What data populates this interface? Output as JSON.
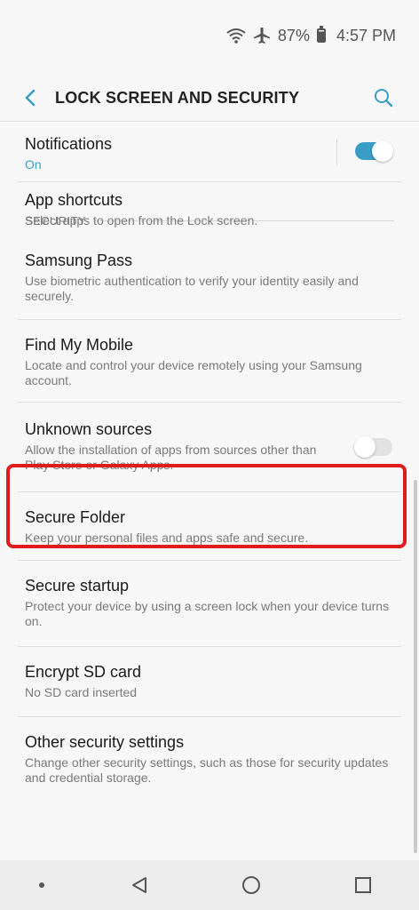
{
  "status": {
    "battery": "87%",
    "time": "4:57 PM"
  },
  "header": {
    "title": "LOCK SCREEN AND SECURITY"
  },
  "items": {
    "notifications": {
      "title": "Notifications",
      "sub": "On"
    },
    "app_shortcuts": {
      "title": "App shortcuts",
      "sub": "Select apps to open from the Lock screen."
    },
    "section": "SECURITY",
    "samsung_pass": {
      "title": "Samsung Pass",
      "sub": "Use biometric authentication to verify your identity easily and securely."
    },
    "find_my_mobile": {
      "title": "Find My Mobile",
      "sub": "Locate and control your device remotely using your Samsung account."
    },
    "unknown_sources": {
      "title": "Unknown sources",
      "sub": "Allow the installation of apps from sources other than Play Store or Galaxy Apps."
    },
    "secure_folder": {
      "title": "Secure Folder",
      "sub": "Keep your personal files and apps safe and secure."
    },
    "secure_startup": {
      "title": "Secure startup",
      "sub": "Protect your device by using a screen lock when your device turns on."
    },
    "encrypt_sd": {
      "title": "Encrypt SD card",
      "sub": "No SD card inserted"
    },
    "other_security": {
      "title": "Other security settings",
      "sub": "Change other security settings, such as those for security updates and credential storage."
    }
  },
  "toggles": {
    "notifications_on": true,
    "unknown_sources_on": false
  },
  "colors": {
    "accent": "#3a9dc6",
    "highlight": "#e01b1b"
  }
}
